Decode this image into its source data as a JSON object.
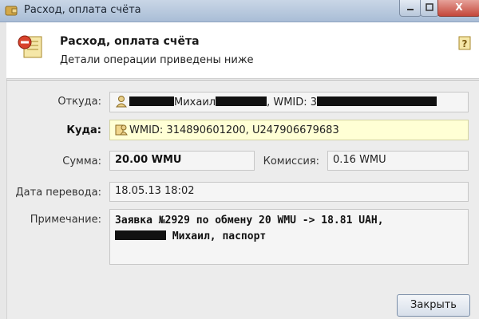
{
  "window": {
    "title": "Расход, оплата счёта",
    "close_label": "X"
  },
  "header": {
    "title": "Расход, оплата счёта",
    "subtitle": "Детали операции приведены ниже"
  },
  "fields": {
    "from": {
      "label": "Откуда:",
      "name_visible": "Михаил",
      "wmid_prefix": ", WMID: 3"
    },
    "to": {
      "label": "Куда:",
      "value": "WMID: 314890601200, U247906679683"
    },
    "amount": {
      "label": "Сумма:",
      "value": "20.00 WMU"
    },
    "commission": {
      "label": "Комиссия:",
      "value": "0.16 WMU"
    },
    "date": {
      "label": "Дата перевода:",
      "value": "18.05.13 18:02"
    },
    "note": {
      "label": "Примечание:",
      "line1": "Заявка №2929 по обмену 20 WMU -> 18.81 UAH,",
      "line2_visible": " Михаил, паспорт"
    }
  },
  "buttons": {
    "close": "Закрыть"
  },
  "colors": {
    "highlight": "#ffffd5",
    "field_bg": "#f5f5f5"
  }
}
